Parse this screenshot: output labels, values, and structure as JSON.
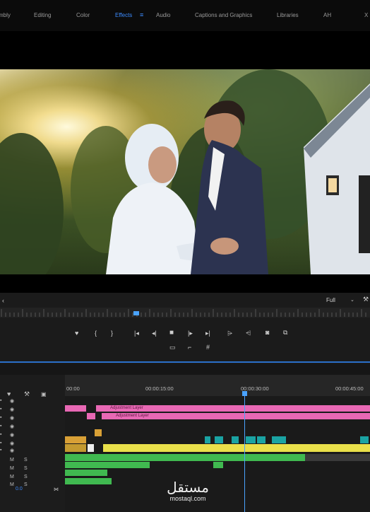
{
  "workspaces": [
    {
      "label": "mbly",
      "active": false
    },
    {
      "label": "Editing",
      "active": false
    },
    {
      "label": "Color",
      "active": false
    },
    {
      "label": "Effects",
      "active": true
    },
    {
      "label": "Audio",
      "active": false
    },
    {
      "label": "Captions and Graphics",
      "active": false
    },
    {
      "label": "Libraries",
      "active": false
    },
    {
      "label": "AH",
      "active": false
    },
    {
      "label": "X",
      "active": false
    }
  ],
  "monitor": {
    "resolution": "Full",
    "icons": [
      "marker-icon",
      "in-point-icon",
      "out-point-icon",
      "go-to-in-icon",
      "step-back-icon",
      "stop-icon",
      "step-forward-icon",
      "go-to-out-icon",
      "lift-icon",
      "extract-icon",
      "camera-icon",
      "compare-icon",
      "safe-margins-icon",
      "crop-icon",
      "settings-grid-icon"
    ]
  },
  "timeline": {
    "timecodes": [
      "00:00",
      "00:00:15:00",
      "00:00:30:00",
      "00:00:45:00"
    ],
    "clips": {
      "adjustment_1": "Adjustment Layer",
      "adjustment_2": "Adjustment Layer"
    },
    "audio_value": "0.0",
    "track_letters": {
      "m": "M",
      "s": "S"
    }
  },
  "watermark": {
    "arabic": "مستقل",
    "latin": "mostaql.com"
  },
  "colors": {
    "accent": "#3d8cff",
    "adjustment": "#e868b4",
    "video_clip": "#e9e04a",
    "audio_clip": "#40b950",
    "teal": "#1aa3a3",
    "orange": "#d8a036"
  }
}
